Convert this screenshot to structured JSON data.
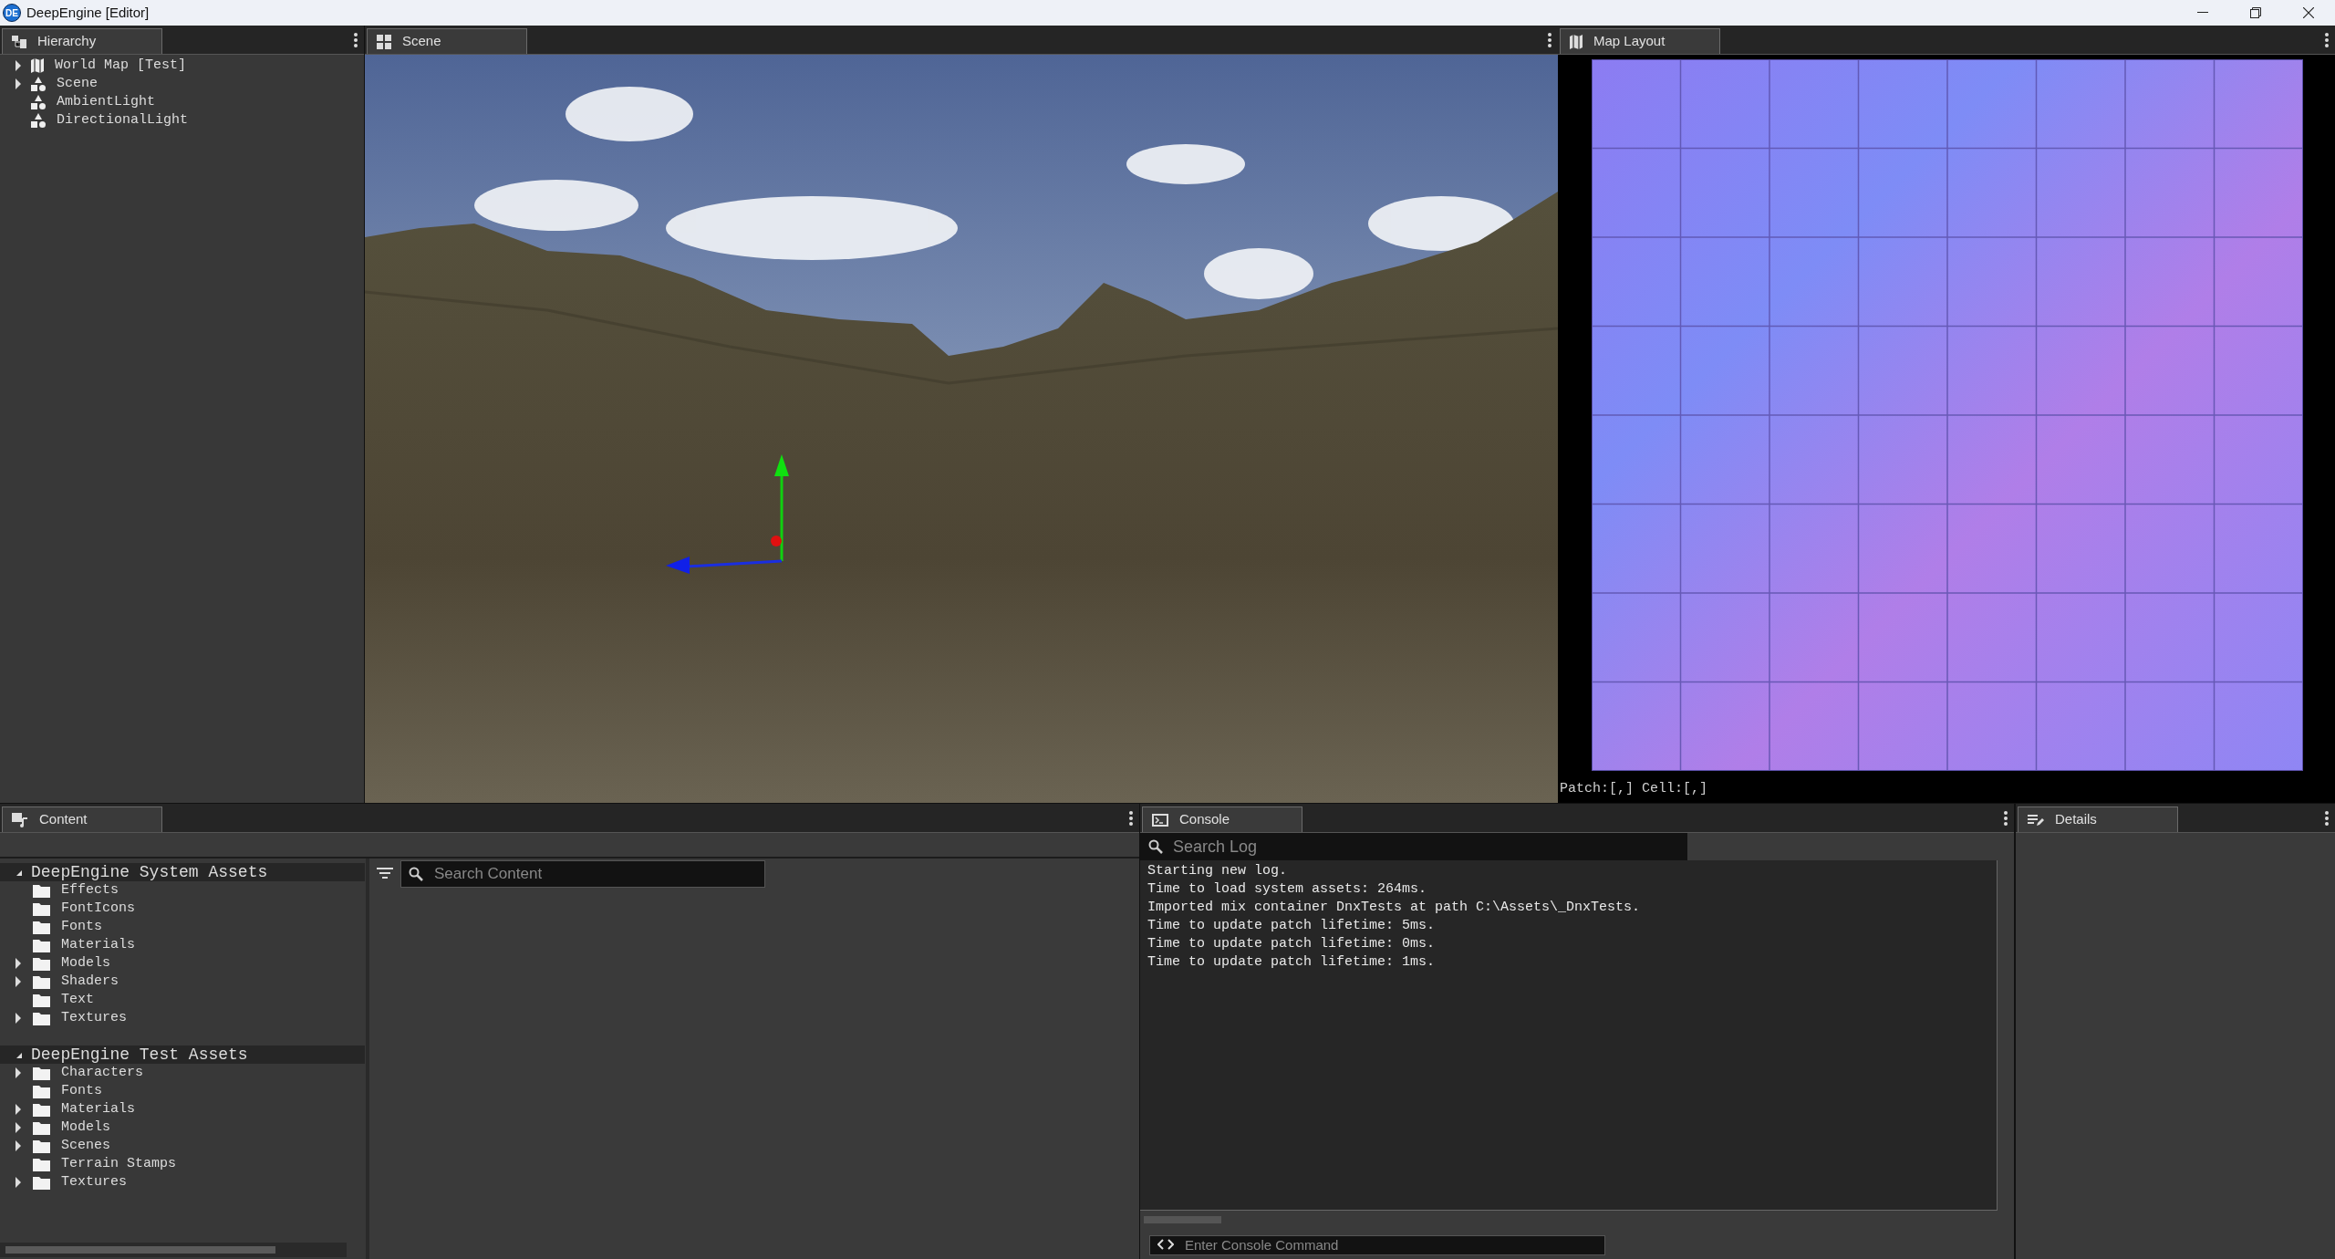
{
  "window": {
    "title": "DeepEngine [Editor]",
    "logo_text": "DE"
  },
  "hierarchy": {
    "tab": "Hierarchy",
    "items": [
      {
        "label": "World Map [Test]",
        "kind": "map",
        "expanded": false
      },
      {
        "label": "Scene",
        "kind": "object",
        "expanded": false
      },
      {
        "label": "AmbientLight",
        "kind": "object"
      },
      {
        "label": "DirectionalLight",
        "kind": "object"
      }
    ]
  },
  "scene": {
    "tab": "Scene"
  },
  "map_layout": {
    "tab": "Map Layout",
    "status": "Patch:[,] Cell:[,]"
  },
  "content": {
    "tab": "Content",
    "search": {
      "placeholder": "Search Content"
    },
    "tree": [
      {
        "label": "DeepEngine System Assets",
        "expanded": true,
        "children": [
          {
            "label": "Effects"
          },
          {
            "label": "FontIcons"
          },
          {
            "label": "Fonts"
          },
          {
            "label": "Materials"
          },
          {
            "label": "Models",
            "expanded": false
          },
          {
            "label": "Shaders",
            "expanded": false
          },
          {
            "label": "Text"
          },
          {
            "label": "Textures",
            "expanded": false
          }
        ]
      },
      {
        "label": "DeepEngine Test Assets",
        "expanded": true,
        "children": [
          {
            "label": "Characters",
            "expanded": false
          },
          {
            "label": "Fonts"
          },
          {
            "label": "Materials",
            "expanded": false
          },
          {
            "label": "Models",
            "expanded": false
          },
          {
            "label": "Scenes",
            "expanded": false
          },
          {
            "label": "Terrain Stamps"
          },
          {
            "label": "Textures",
            "expanded": false
          }
        ]
      }
    ]
  },
  "console": {
    "tab": "Console",
    "search": {
      "placeholder": "Search Log"
    },
    "lines": [
      "Starting new log.",
      "Time to load system assets: 264ms.",
      "Imported mix container DnxTests at path C:\\Assets\\_DnxTests.",
      "Time to update patch lifetime: 5ms.",
      "Time to update patch lifetime: 0ms.",
      "Time to update patch lifetime: 1ms."
    ],
    "command": {
      "placeholder": "Enter Console Command"
    }
  },
  "details": {
    "tab": "Details"
  }
}
